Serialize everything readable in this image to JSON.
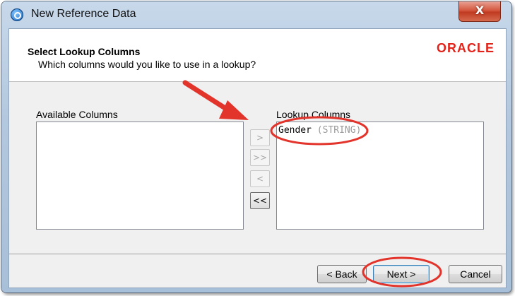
{
  "window": {
    "title": "New Reference Data",
    "close_label": "X"
  },
  "header": {
    "title": "Select Lookup Columns",
    "subtitle": "Which columns would you like to use in a lookup?",
    "logo_text": "ORACLE"
  },
  "available": {
    "label": "Available Columns",
    "items": []
  },
  "lookup": {
    "label": "Lookup Columns",
    "items": [
      {
        "name": "Gender",
        "type": "(STRING)"
      }
    ]
  },
  "move_buttons": {
    "add": ">",
    "add_all": ">>",
    "remove": "<",
    "remove_all": "<<"
  },
  "footer": {
    "back": "< Back",
    "next": "Next >",
    "cancel": "Cancel"
  },
  "colors": {
    "annotation_red": "#e3342c",
    "logo_red": "#e2231a",
    "title_blue": "#b3c8de"
  }
}
